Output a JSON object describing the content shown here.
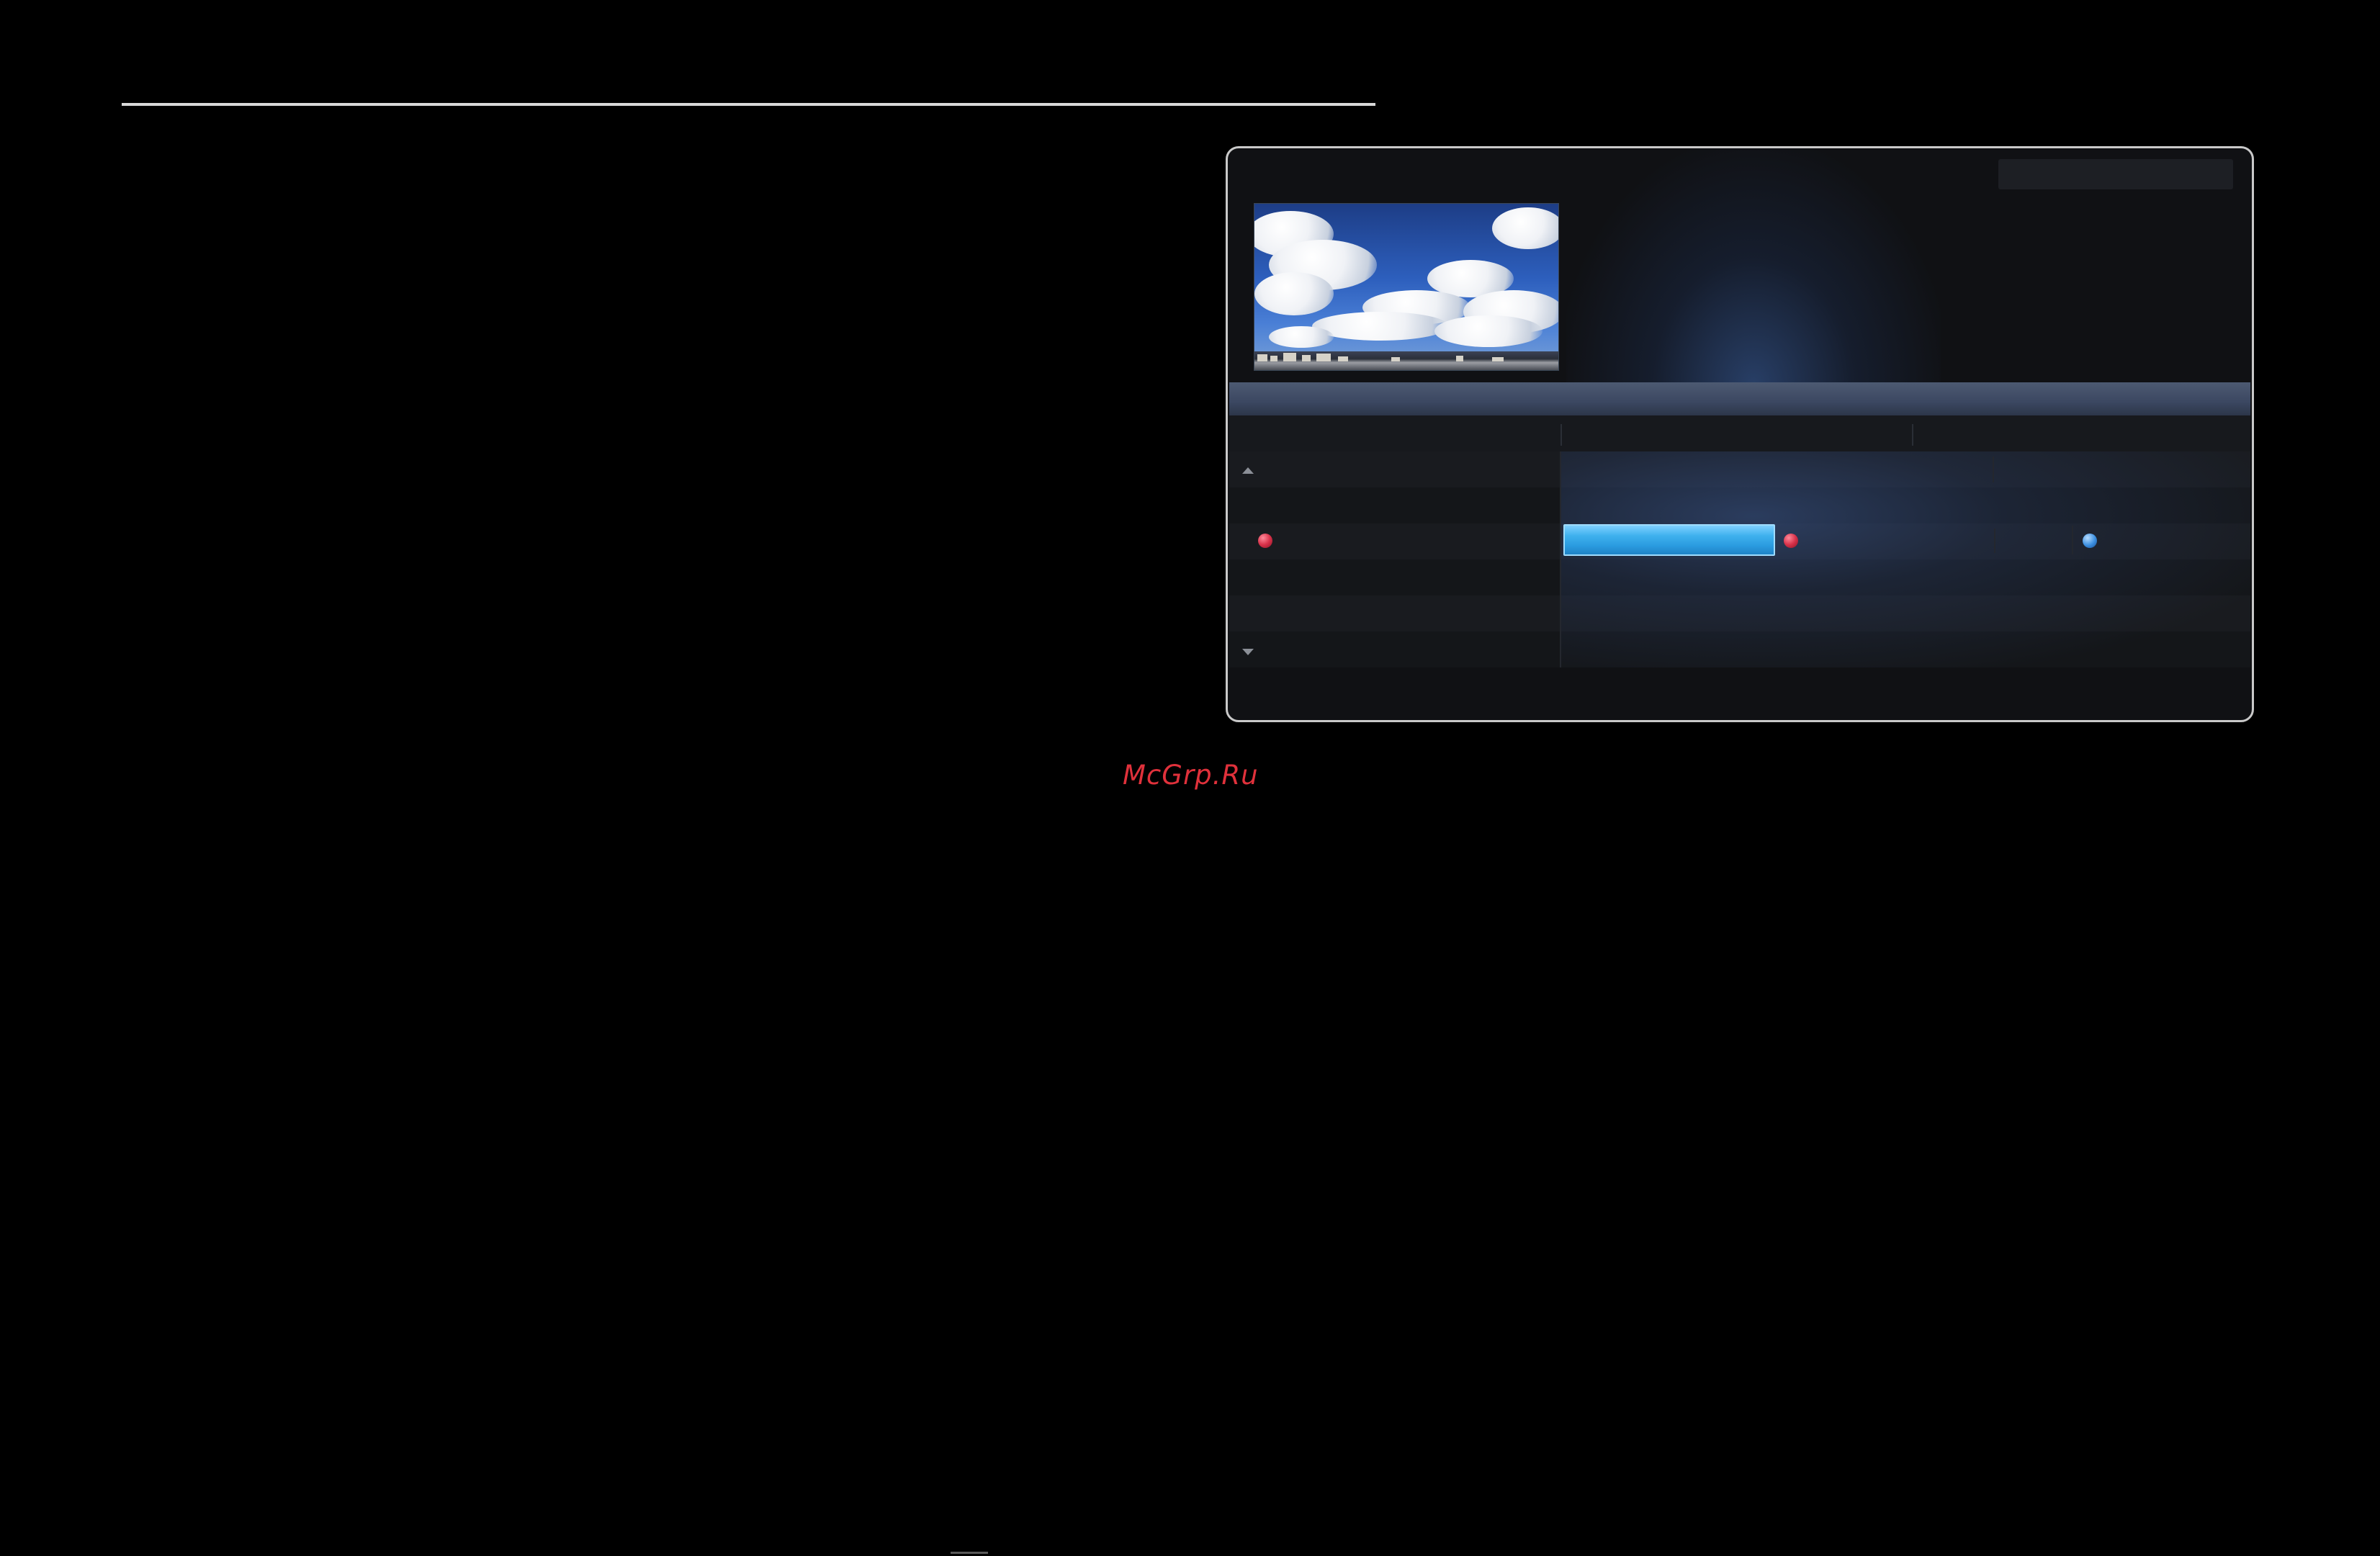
{
  "watermark": {
    "text": "McGrp.Ru",
    "color": "#e0313b"
  },
  "guide_screen": {
    "preview": {
      "content": "sky-with-clouds-over-city"
    },
    "schedule": {
      "scroll_up_icon": "triangle-up-icon",
      "scroll_down_icon": "triangle-down-icon",
      "highlight_color": "#3fb1ee",
      "markers": [
        {
          "icon": "red-circle-icon",
          "color": "#d8324a"
        },
        {
          "icon": "red-circle-icon",
          "color": "#d8324a"
        },
        {
          "icon": "blue-circle-icon",
          "color": "#3a8ee0"
        }
      ]
    }
  }
}
